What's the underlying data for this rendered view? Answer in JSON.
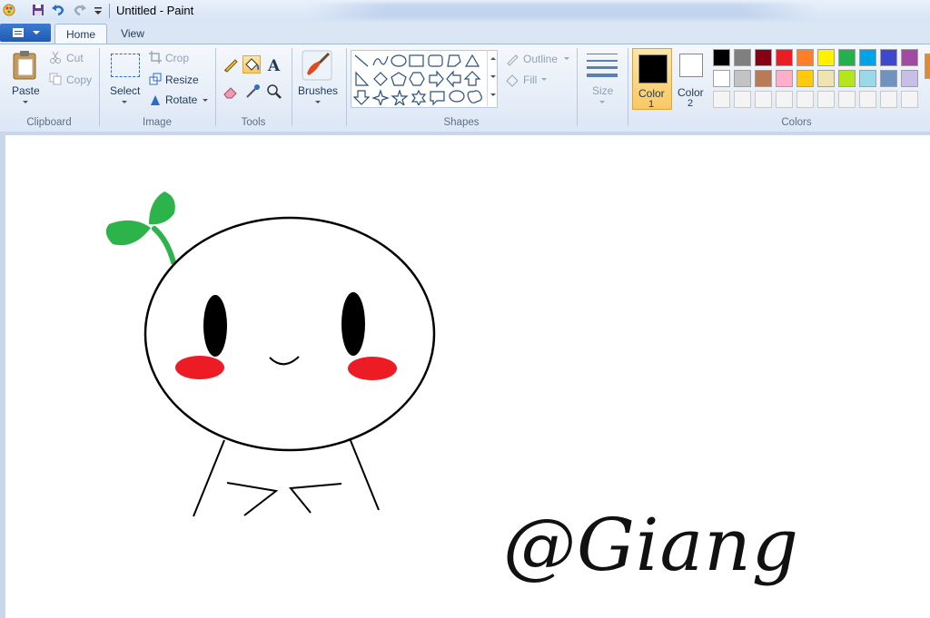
{
  "window": {
    "title": "Untitled - Paint"
  },
  "tabs": [
    {
      "label": "Home"
    },
    {
      "label": "View"
    }
  ],
  "ribbon": {
    "clipboard": {
      "paste_label": "Paste",
      "cut_label": "Cut",
      "copy_label": "Copy",
      "group_label": "Clipboard"
    },
    "image": {
      "select_label": "Select",
      "crop_label": "Crop",
      "resize_label": "Resize",
      "rotate_label": "Rotate",
      "group_label": "Image"
    },
    "tools": {
      "group_label": "Tools",
      "active_tool": "fill"
    },
    "brushes": {
      "label": "Brushes"
    },
    "shapes": {
      "outline_label": "Outline",
      "fill_label": "Fill",
      "group_label": "Shapes"
    },
    "size": {
      "label": "Size"
    },
    "colors": {
      "color1_label": "Color",
      "color1_number": "1",
      "color2_label": "Color",
      "color2_number": "2",
      "group_label": "Colors",
      "color1_value": "#000000",
      "color2_value": "#ffffff",
      "palette_row1": [
        "#000000",
        "#7f7f7f",
        "#880015",
        "#ed1c24",
        "#ff7f27",
        "#fff200",
        "#22b14c",
        "#00a2e8",
        "#3f48cc",
        "#a349a4"
      ],
      "palette_row2": [
        "#ffffff",
        "#c3c3c3",
        "#b97a57",
        "#ffaec9",
        "#ffc90e",
        "#efe4b0",
        "#b5e61d",
        "#99d9ea",
        "#7092be",
        "#c8bfe7"
      ]
    }
  },
  "canvas": {
    "signature_text": "@Giang"
  }
}
